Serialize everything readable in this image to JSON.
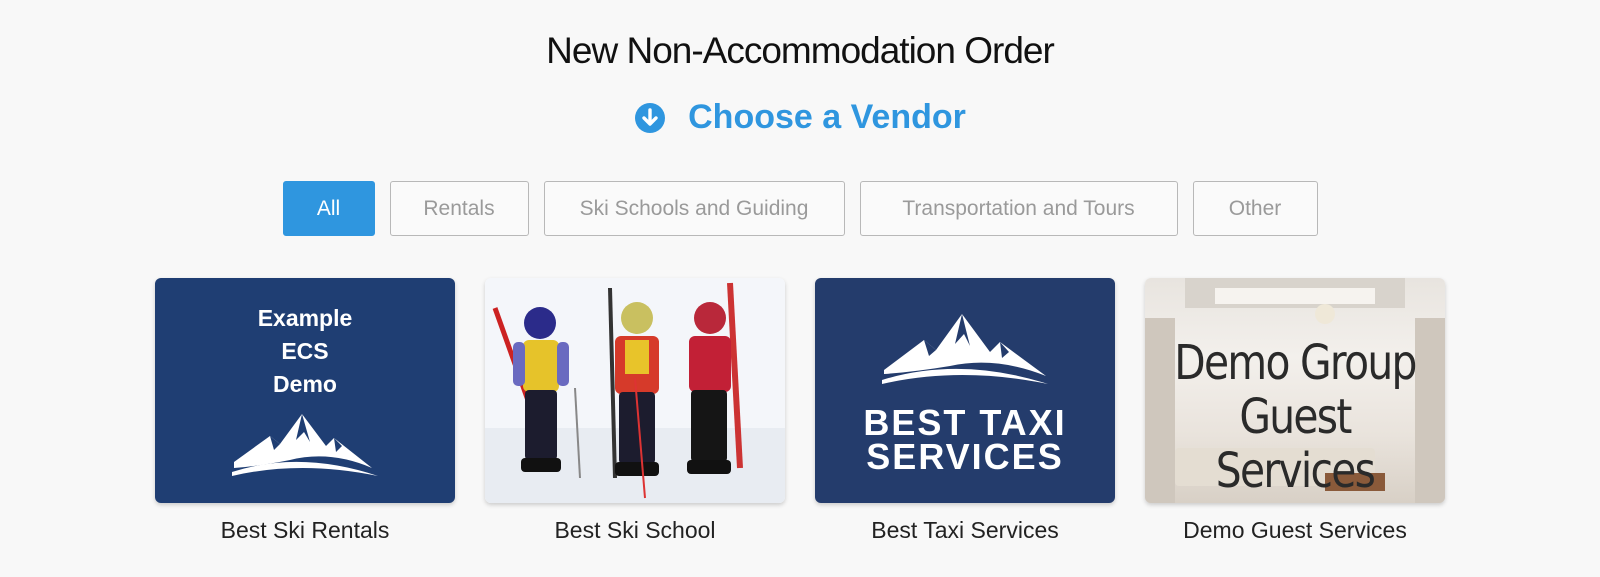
{
  "page": {
    "title": "New Non-Accommodation Order"
  },
  "subtitle": {
    "text": "Choose a Vendor",
    "icon": "arrow-down-circle-icon",
    "color": "#2f96df"
  },
  "filters": [
    {
      "label": "All",
      "active": true
    },
    {
      "label": "Rentals",
      "active": false
    },
    {
      "label": "Ski Schools and Guiding",
      "active": false
    },
    {
      "label": "Transportation and Tours",
      "active": false
    },
    {
      "label": "Other",
      "active": false
    }
  ],
  "vendors": [
    {
      "name": "Best Ski Rentals",
      "image_text": [
        "Example",
        "ECS",
        "Demo"
      ]
    },
    {
      "name": "Best Ski School"
    },
    {
      "name": "Best Taxi Services",
      "image_text": [
        "BEST TAXI",
        "SERVICES"
      ]
    },
    {
      "name": "Demo Guest Services",
      "image_text": [
        "Demo Group",
        "Guest Services"
      ]
    }
  ],
  "colors": {
    "accent": "#2f96df",
    "navy": "#1f3e73",
    "background": "#f8f8f8"
  }
}
